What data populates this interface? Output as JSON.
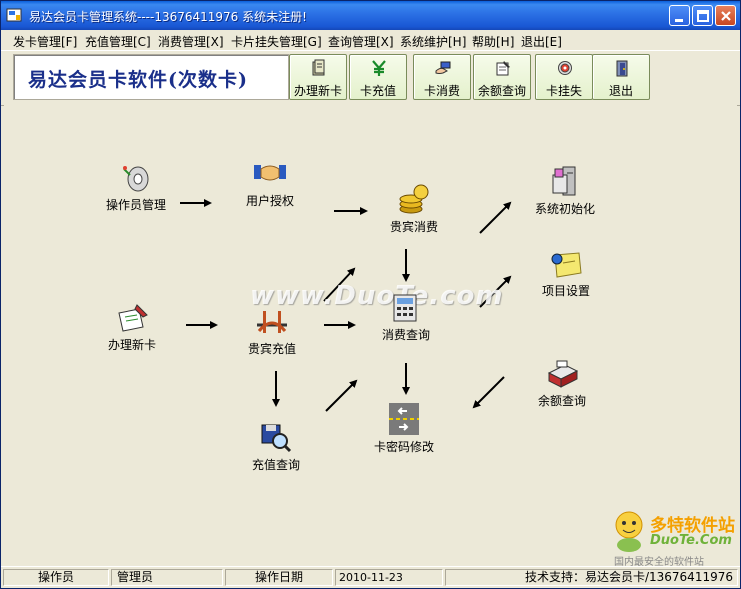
{
  "window": {
    "title": "易达会员卡管理系统----13676411976  系统未注册!"
  },
  "menu": [
    {
      "label": "发卡管理[F]"
    },
    {
      "label": "充值管理[C]"
    },
    {
      "label": "消费管理[X]"
    },
    {
      "label": "卡片挂失管理[G]"
    },
    {
      "label": "查询管理[X]"
    },
    {
      "label": "系统维护[H]"
    },
    {
      "label": "帮助[H]"
    },
    {
      "label": "退出[E]"
    }
  ],
  "toolbar": {
    "brand": "易达会员卡软件(次数卡)",
    "buttons": [
      {
        "label": "办理新卡",
        "icon": "card-icon"
      },
      {
        "label": "卡充值",
        "icon": "yen-icon"
      },
      {
        "label": "卡消费",
        "icon": "hand-card-icon"
      },
      {
        "label": "余额查询",
        "icon": "notepad-icon"
      },
      {
        "label": "卡挂失",
        "icon": "target-icon"
      },
      {
        "label": "退出",
        "icon": "door-exit-icon"
      }
    ]
  },
  "flow": {
    "nodes": [
      {
        "label": "操作员管理",
        "icon": "key-icon"
      },
      {
        "label": "用户授权",
        "icon": "handshake-icon"
      },
      {
        "label": "贵宾消费",
        "icon": "coins-icon"
      },
      {
        "label": "系统初始化",
        "icon": "machine-icon"
      },
      {
        "label": "项目设置",
        "icon": "note-pin-icon"
      },
      {
        "label": "办理新卡",
        "icon": "card-pen-icon"
      },
      {
        "label": "贵宾充值",
        "icon": "bridge-icon"
      },
      {
        "label": "消费查询",
        "icon": "calculator-icon"
      },
      {
        "label": "余额查询",
        "icon": "register-icon"
      },
      {
        "label": "充值查询",
        "icon": "disk-search-icon"
      },
      {
        "label": "卡密码修改",
        "icon": "road-sign-icon"
      }
    ]
  },
  "watermark": "www.DuoTe.com",
  "corner_logo": {
    "line1": "多特软件站",
    "line2": "DuoTe.Com",
    "line3": "国内最安全的软件站"
  },
  "status": {
    "operator_label": "操作员",
    "operator_value": "管理员",
    "date_label": "操作日期",
    "date_value": "2010-11-23",
    "support": "技术支持：易达会员卡/13676411976"
  },
  "colors": {
    "titlebar": "#2D73E6",
    "brand_text": "#1A2F8A",
    "toolbar_button": "#E4F1CC",
    "background": "#ECE9D8"
  }
}
